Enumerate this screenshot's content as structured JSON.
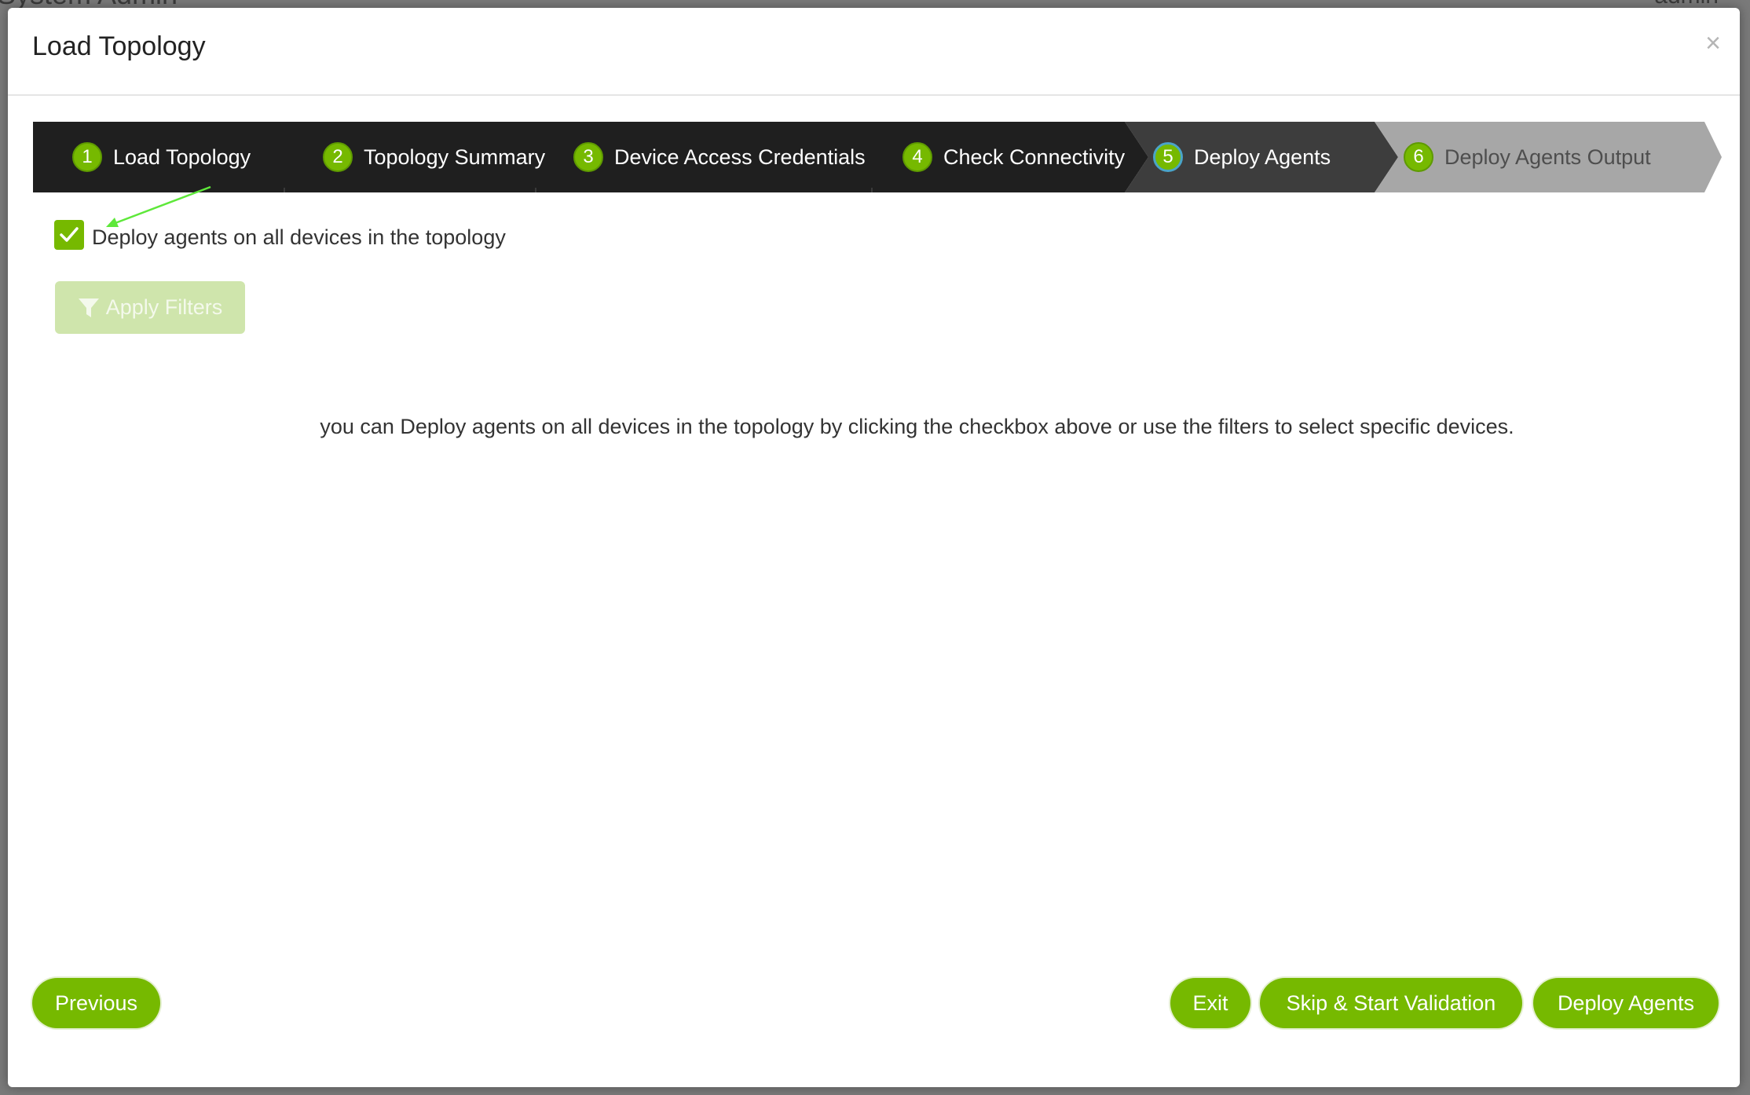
{
  "background": {
    "page_title": "System Admin",
    "user": "admin"
  },
  "modal": {
    "title": "Load Topology",
    "close_symbol": "×"
  },
  "wizard": {
    "steps": [
      {
        "num": "1",
        "label": "Load Topology",
        "state": "done"
      },
      {
        "num": "2",
        "label": "Topology Summary",
        "state": "done"
      },
      {
        "num": "3",
        "label": "Device Access Credentials",
        "state": "done"
      },
      {
        "num": "4",
        "label": "Check Connectivity",
        "state": "done"
      },
      {
        "num": "5",
        "label": "Deploy Agents",
        "state": "active"
      },
      {
        "num": "6",
        "label": "Deploy Agents Output",
        "state": "todo"
      }
    ]
  },
  "content": {
    "deploy_all_checked": true,
    "deploy_all_label": "Deploy agents on all devices in the topology",
    "apply_filters_label": "Apply Filters",
    "hint": "you can Deploy agents on all devices in the topology by clicking the checkbox above or use the filters to select specific devices."
  },
  "footer": {
    "previous_label": "Previous",
    "exit_label": "Exit",
    "skip_label": "Skip & Start Validation",
    "deploy_label": "Deploy Agents"
  },
  "colors": {
    "accent": "#76b900",
    "wizard_done": "#1f1f1f",
    "wizard_active": "#3d3d3d",
    "wizard_todo": "#a7a7a7",
    "annotation_arrow": "#5ee83a"
  },
  "icons": {
    "close": "close-icon",
    "check": "checkmark-icon",
    "filter": "filter-icon"
  }
}
